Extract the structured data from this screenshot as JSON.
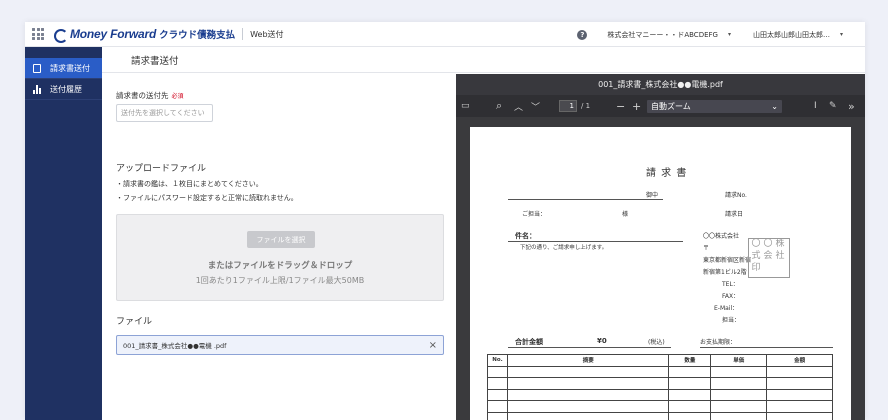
{
  "topbar": {
    "brand": "Money Forward",
    "product": "クラウド債務支払",
    "subproduct": "Web送付",
    "help": "?",
    "company": "株式会社マニーー・・ドABCDEFG",
    "user": "山田太郎山郎山田太郎…",
    "caret": "▾"
  },
  "sidebar": {
    "items": [
      {
        "label": "請求書送付",
        "icon": "document-icon",
        "active": true
      },
      {
        "label": "送付履歴",
        "icon": "chart-icon",
        "active": false
      }
    ]
  },
  "page": {
    "title": "請求書送付"
  },
  "form": {
    "dest_label": "請求書の送付先",
    "required": "必須",
    "dest_placeholder": "送付先を選択してください",
    "upload_heading": "アップロードファイル",
    "notes": [
      "・請求書の鑑は、１枚目にまとめてください。",
      "・ファイルにパスワード設定すると正常に読取れません。"
    ],
    "choose_button": "ファイルを選択",
    "drop_main": "またはファイルをドラッグ＆ドロップ",
    "drop_sub": "1回あたり1ファイル上限/1ファイル最大50MB",
    "file_heading": "ファイル",
    "file_name": "001_請求書_株式会社●●電機 .pdf",
    "file_remove": "×"
  },
  "viewer": {
    "title": "001_請求書_株式会社●●電機.pdf",
    "page_current": "1",
    "page_total": "/ 1",
    "zoom": "自動ズーム",
    "toolbar_glyphs": {
      "sidebar": "▭",
      "search": "⌕",
      "up": "︿",
      "down": "﹀",
      "minus": "−",
      "plus": "+",
      "text": "I",
      "draw": "✎",
      "more": "»",
      "caret": "⌄"
    }
  },
  "invoice": {
    "title": "請 求 書",
    "onchu": "御中",
    "invoice_no_label": "請求No.",
    "tantou_label": "ご担当：",
    "sama": "様",
    "date_label": "請求日",
    "kenmei": "件名：",
    "intro": "下記の通り、ご請求申し上げます。",
    "company": "〇〇株式会社",
    "postal": "〒",
    "address1": "東京都新宿区新宿",
    "address2": "新宿第1ビル2階",
    "tel": "TEL：",
    "fax": "FAX：",
    "email": "E-Mail：",
    "staff": "担当：",
    "stamp": "〇〇株式会社印",
    "total_label": "合計金額",
    "total_value": "¥0",
    "tax": "(税込)",
    "due_label": "お支払期限：",
    "table_headers": [
      "No.",
      "摘要",
      "数量",
      "単価",
      "金額"
    ]
  }
}
